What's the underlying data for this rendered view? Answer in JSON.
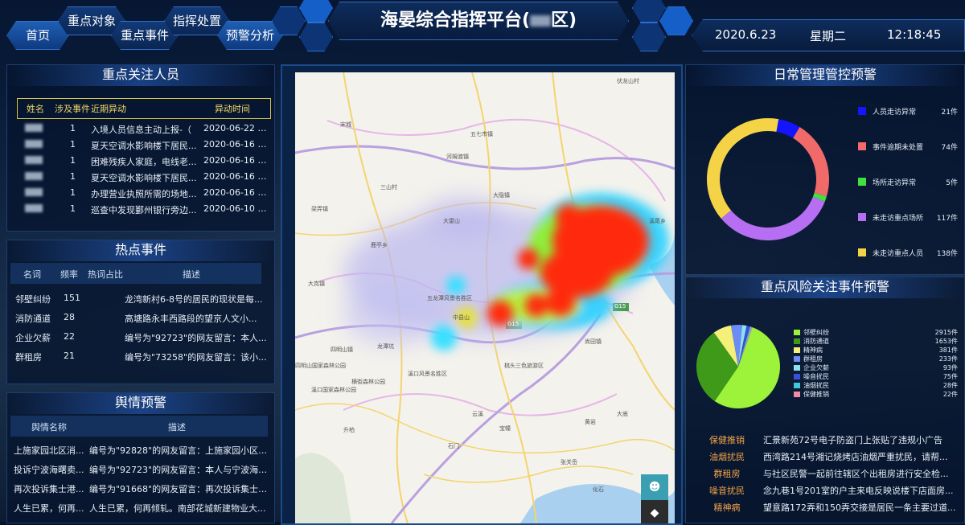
{
  "nav": {
    "home": "首页",
    "key_objects": "重点对象",
    "key_events": "重点事件",
    "command": "指挥处置",
    "warning": "预警分析"
  },
  "header": {
    "title_main": "海晏综合指挥平台(",
    "title_suffix": "区)",
    "date": "2020.6.23",
    "weekday": "星期二",
    "time": "12:18:45"
  },
  "persons": {
    "title": "重点关注人员",
    "headers": [
      "姓名",
      "涉及事件",
      "近期异动",
      "异动时间"
    ],
    "rows": [
      {
        "count": "1",
        "event": "入境人员信息主动上报-（",
        "time": "2020-06-22 0..."
      },
      {
        "count": "1",
        "event": "夏天空调水影响楼下居民...",
        "time": "2020-06-16 0..."
      },
      {
        "count": "1",
        "event": "困难残疾人家庭，电线老...",
        "time": "2020-06-16 0..."
      },
      {
        "count": "1",
        "event": "夏天空调水影响楼下居民...",
        "time": "2020-06-16 0..."
      },
      {
        "count": "1",
        "event": "办理营业执照所需的场地...",
        "time": "2020-06-16 0..."
      },
      {
        "count": "1",
        "event": "巡查中发现鄞州银行旁边...",
        "time": "2020-06-10 0..."
      }
    ]
  },
  "hot": {
    "title": "热点事件",
    "headers": [
      "名词",
      "频率",
      "热词占比",
      "描述"
    ],
    "rows": [
      {
        "name": "邻壁纠纷",
        "freq": "151",
        "desc": "龙湾新村6-8号的居民的现状是每..."
      },
      {
        "name": "消防通道",
        "freq": "28",
        "desc": "高塘路永丰西路段的望京人文小..."
      },
      {
        "name": "企业欠薪",
        "freq": "22",
        "desc": "编号为\"92723\"的网友留言：本人..."
      },
      {
        "name": "群租房",
        "freq": "21",
        "desc": "编号为\"73258\"的网友留言：该小..."
      }
    ]
  },
  "opinion": {
    "title": "舆情预警",
    "headers": [
      "舆情名称",
      "描述"
    ],
    "rows": [
      {
        "name": "上施家园北区消...",
        "desc": "编号为\"92828\"的网友留言：上施家园小区外..."
      },
      {
        "name": "投诉宁波海曙卖...",
        "desc": "编号为\"92723\"的网友留言：本人与宁波海曙..."
      },
      {
        "name": "再次投诉集士港...",
        "desc": "编号为\"91668\"的网友留言：再次投诉集士港..."
      },
      {
        "name": "人生已累，何再...",
        "desc": "人生已累，何再倾轧。南部花城新建物业大..."
      }
    ]
  },
  "map": {
    "labels": [
      "伏龙山村",
      "宋城",
      "五七市镇",
      "河姆渡镇",
      "三山村",
      "大隐镇",
      "大雷山",
      "梁弄镇",
      "鹿亭乡",
      "大岚镇",
      "五龙潭风景名胜区",
      "中县山",
      "龙潭坑",
      "四明山镇",
      "四明山国家森林公园",
      "溪口风景名胜区",
      "横街森林公园",
      "溪口国家森林公园",
      "尚田镇",
      "云溪",
      "升柏",
      "石门",
      "宝幢",
      "大嵩",
      "张关岙",
      "化石",
      "黄岩",
      "桃头三色旅游区",
      "溪尾乡"
    ],
    "road": "G15"
  },
  "daily": {
    "title": "日常管理管控预警",
    "items": [
      {
        "label": "人员走访异常",
        "value": "21件",
        "color": "#1414ff",
        "num": 21
      },
      {
        "label": "事件逾期未处置",
        "value": "74件",
        "color": "#f06a6a",
        "num": 74
      },
      {
        "label": "场所走访异常",
        "value": "5件",
        "color": "#3fe03f",
        "num": 5
      },
      {
        "label": "未走访重点场所",
        "value": "117件",
        "color": "#b66ef2",
        "num": 117
      },
      {
        "label": "未走访重点人员",
        "value": "138件",
        "color": "#f5d347",
        "num": 138
      }
    ]
  },
  "risk": {
    "title": "重点风险关注事件预警",
    "items": [
      {
        "label": "邻壁纠纷",
        "value": "2915件",
        "color": "#9df23a",
        "num": 2915
      },
      {
        "label": "消防通道",
        "value": "1653件",
        "color": "#3f9a1a",
        "num": 1653
      },
      {
        "label": "精神病",
        "value": "381件",
        "color": "#f5f07a",
        "num": 381
      },
      {
        "label": "群租房",
        "value": "233件",
        "color": "#6b8df5",
        "num": 233
      },
      {
        "label": "企业欠薪",
        "value": "93件",
        "color": "#8fe0ef",
        "num": 93
      },
      {
        "label": "噪音扰民",
        "value": "75件",
        "color": "#3a50d8",
        "num": 75
      },
      {
        "label": "油烟扰民",
        "value": "28件",
        "color": "#3fc9d9",
        "num": 28
      },
      {
        "label": "保健推销",
        "value": "22件",
        "color": "#f28aa8",
        "num": 22
      }
    ],
    "alerts": [
      {
        "k": "保健推销",
        "v": "汇景新苑72号电子防盗门上张贴了违规小广告"
      },
      {
        "k": "油烟扰民",
        "v": "西湾路214号湘记烧烤店油烟严重扰民，请帮..."
      },
      {
        "k": "群租房",
        "v": "与社区民警一起前往辖区个出租房进行安全检..."
      },
      {
        "k": "噪音扰民",
        "v": "念九巷1号201室的户主来电反映说楼下店面房..."
      },
      {
        "k": "精神病",
        "v": "望意路172弄和150弄交接是居民一条主要过道..."
      }
    ]
  },
  "colors": {
    "accent": "#2f6fc8",
    "alert_key": "#f3a34a"
  }
}
